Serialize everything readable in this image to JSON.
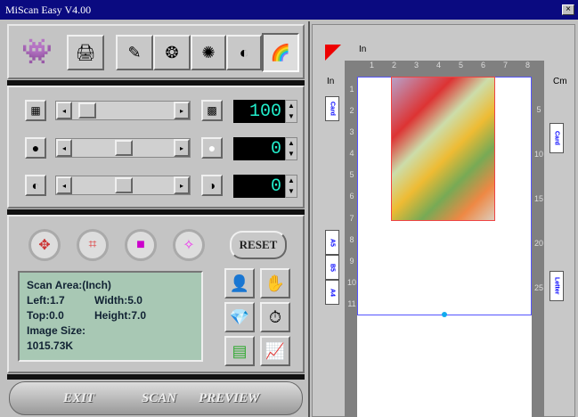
{
  "window": {
    "title": "MiScan Easy V4.00",
    "close": "×"
  },
  "toolbar": {
    "icons": [
      "mascot-icon",
      "scanner-icon",
      "lineart-icon",
      "halftone-icon",
      "gray-icon",
      "bw-gray-icon",
      "color-icon"
    ]
  },
  "sliders": [
    {
      "name": "resolution",
      "value": "100",
      "fraction": 0.05
    },
    {
      "name": "brightness",
      "value": "0",
      "fraction": 0.5
    },
    {
      "name": "contrast",
      "value": "0",
      "fraction": 0.5
    }
  ],
  "tools": {
    "reset": "RESET"
  },
  "info": {
    "line1": "Scan Area:(Inch)",
    "left": "Left:1.7",
    "width": "Width:5.0",
    "top": "Top:0.0",
    "height": "Height:7.0",
    "size_label": "Image Size:",
    "size": "1015.73K"
  },
  "bottom": {
    "exit": "EXIT",
    "scan": "SCAN",
    "preview": "PREVIEW"
  },
  "preview": {
    "unit_top": "In",
    "unit_left": "In",
    "unit_right": "Cm",
    "top_ticks": [
      "1",
      "2",
      "3",
      "4",
      "5",
      "6",
      "7",
      "8"
    ],
    "left_ticks": [
      "1",
      "2",
      "3",
      "4",
      "5",
      "6",
      "7",
      "8",
      "9",
      "10",
      "11"
    ],
    "right_ticks": [
      "5",
      "10",
      "15",
      "20",
      "25"
    ],
    "left_papers": [
      "Card",
      "A5",
      "B5",
      "A4"
    ],
    "right_papers": [
      "Card",
      "Letter"
    ]
  }
}
